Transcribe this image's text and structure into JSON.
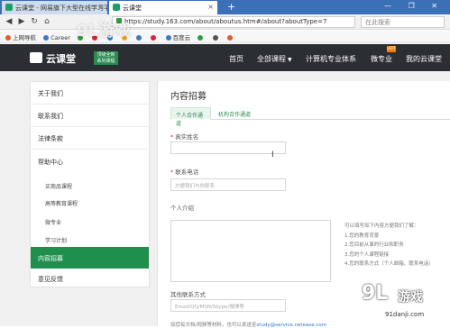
{
  "browser": {
    "tabs": [
      {
        "label": "云课堂 - 网易旗下大型在线学习平"
      },
      {
        "label": "云课堂"
      }
    ],
    "new_tab": "+",
    "window_controls": "— ❐ ✕",
    "url": "https://study.163.com/about/aboutus.htm#/about?aboutType=7",
    "search_placeholder": "在此搜索",
    "bookmarks": [
      "上网导航",
      "Career",
      "",
      "",
      "",
      "",
      "",
      "",
      "百度云",
      "",
      "",
      ""
    ]
  },
  "header": {
    "logo": "云课堂",
    "badge_line1": "顶级全新",
    "badge_line2": "系列课程",
    "nav": [
      "首页",
      "全部课程",
      "计算机专业体系",
      "微专业",
      "我的云课堂"
    ],
    "hot_badge": "HOT"
  },
  "sidebar": {
    "items": [
      {
        "label": "关于我们"
      },
      {
        "label": "联系我们"
      },
      {
        "label": "法律条款"
      },
      {
        "label": "帮助中心"
      },
      {
        "label": "买商品课程"
      },
      {
        "label": "高等教育课程"
      },
      {
        "label": "微专业"
      },
      {
        "label": "学习计划"
      },
      {
        "label": "内容招募"
      },
      {
        "label": "意见反馈"
      }
    ]
  },
  "content": {
    "title": "内容招募",
    "tabs": [
      "个人合作通道",
      "机构合作通道"
    ],
    "fields": {
      "name_label": "真实姓名",
      "phone_label": "联系电话",
      "phone_placeholder": "方便我们与你联系",
      "intro_label": "个人介绍",
      "contact_label": "其他联系方式",
      "contact_placeholder": "Email/QQ/MSN/Skype/微博等"
    },
    "hint": [
      "可以填写如下内容方便我们了解：",
      "1.您的教育背景",
      "2.您目前从事的行业和职务",
      "3.您的个人课程链接",
      "4.您的联系方式（个人邮箱、联系电话）"
    ],
    "footnote_prefix": "如您有文档/视频等材料，也可以发送至",
    "footnote_mail": "study@service.netease.com"
  },
  "watermark": {
    "logo": "9L",
    "text": "游戏",
    "url": "91danji.com",
    "top": "9L游戏"
  }
}
